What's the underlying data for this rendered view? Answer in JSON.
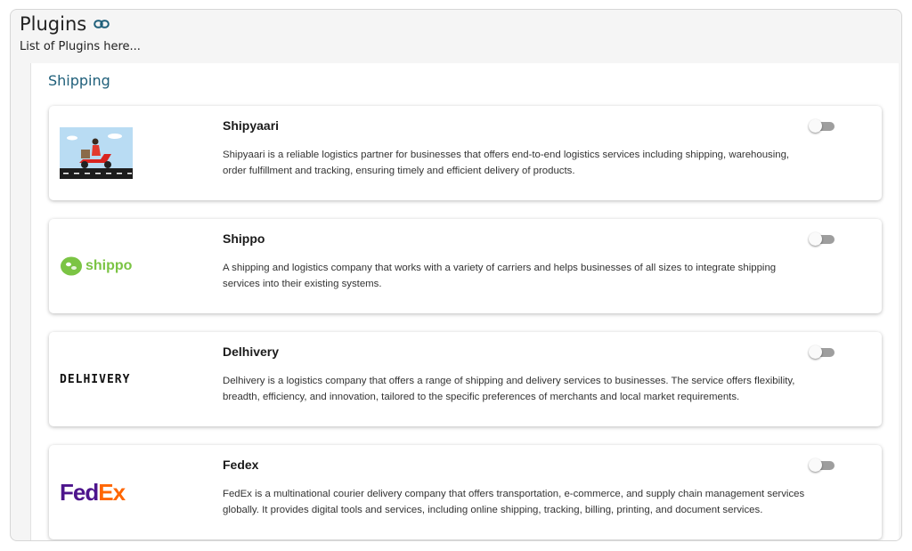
{
  "header": {
    "title": "Plugins",
    "subtitle": "List of Plugins here..."
  },
  "section": {
    "title": "Shipping"
  },
  "plugins": [
    {
      "name": "Shipyaari",
      "description": "Shipyaari is a reliable logistics partner for businesses that offers end-to-end logistics services including shipping, warehousing, order fulfillment and tracking, ensuring timely and efficient delivery of products.",
      "enabled": false,
      "logo": "shipyaari-scooter-illustration"
    },
    {
      "name": "Shippo",
      "description": "A shipping and logistics company that works with a variety of carriers and helps businesses of all sizes to integrate shipping services into their existing systems.",
      "enabled": false,
      "logo_text": "shippo"
    },
    {
      "name": "Delhivery",
      "description": "Delhivery is a logistics company that offers a range of shipping and delivery services to businesses. The service offers flexibility, breadth, efficiency, and innovation, tailored to the specific preferences of merchants and local market requirements.",
      "enabled": false,
      "logo_text": "DELHIVERY"
    },
    {
      "name": "Fedex",
      "description": "FedEx is a multinational courier delivery company that offers transportation, e-commerce, and supply chain management services globally. It provides digital tools and services, including online shipping, tracking, billing, printing, and document services.",
      "enabled": false,
      "logo_text_1": "Fed",
      "logo_text_2": "Ex"
    }
  ],
  "colors": {
    "section_title": "#1f5f7a",
    "shippo_green": "#7bc444",
    "fedex_purple": "#4d148c",
    "fedex_orange": "#ff6600",
    "toggle_track": "#9e9e9e"
  }
}
